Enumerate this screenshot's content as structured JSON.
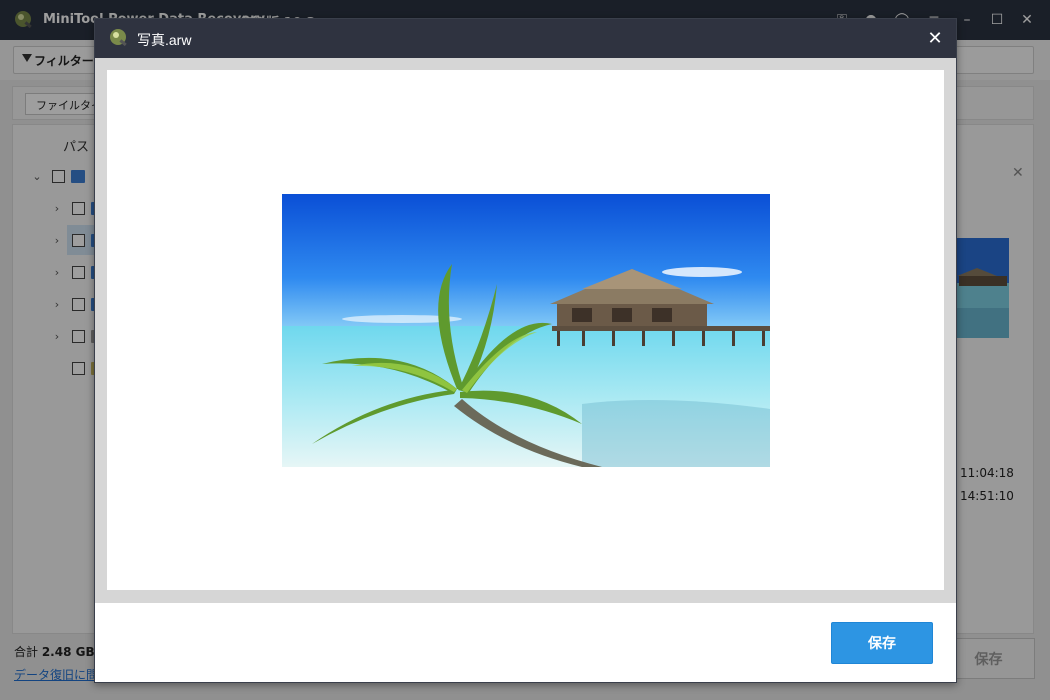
{
  "app": {
    "title": "MiniTool Power Data Recovery",
    "edition": "無料版 10.2"
  },
  "toolbar": {
    "filter_label": "フィルター"
  },
  "subbar": {
    "file_type_label": "ファイルタイプ"
  },
  "tree": {
    "path_header": "パス"
  },
  "details": {
    "time_1": "11:04:18",
    "time_2": "14:51:10"
  },
  "footer": {
    "total_prefix": "合計 ",
    "total_value": "2.48 GB / ",
    "help_link": "データ復旧に問題がありますか？",
    "save_label": "保存"
  },
  "modal": {
    "title": "写真.arw",
    "save_label": "保存"
  },
  "colors": {
    "titlebar": "#2b3241",
    "modal_titlebar": "#2f3340",
    "primary_button": "#2d95e3",
    "link": "#1f6fd1"
  }
}
